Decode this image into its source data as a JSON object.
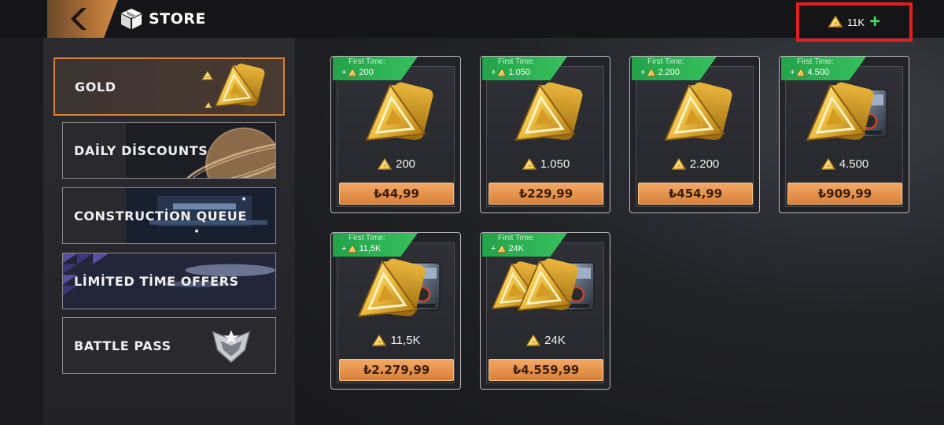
{
  "header": {
    "title": "STORE",
    "currency_value": "11K",
    "add_label": "+"
  },
  "sidebar": {
    "items": [
      {
        "label": "GOLD",
        "active": true
      },
      {
        "label": "DAİLY DİSCOUNTS",
        "active": false
      },
      {
        "label": "CONSTRUCTİON QUEUE",
        "active": false
      },
      {
        "label": "LİMİTED TİME OFFERS",
        "active": false
      },
      {
        "label": "BATTLE PASS",
        "active": false
      }
    ]
  },
  "offers": [
    {
      "first_time_label": "First Time:",
      "bonus": "+ ",
      "bonus_value": "200",
      "amount": "200",
      "price": "₺44,99",
      "art": "gold-cards-icon"
    },
    {
      "first_time_label": "First Time:",
      "bonus": "+ ",
      "bonus_value": "1.050",
      "amount": "1.050",
      "price": "₺229,99",
      "art": "gold-cards-icon"
    },
    {
      "first_time_label": "First Time:",
      "bonus": "+ ",
      "bonus_value": "2.200",
      "amount": "2.200",
      "price": "₺454,99",
      "art": "gold-cards-icon"
    },
    {
      "first_time_label": "First Time:",
      "bonus": "+ ",
      "bonus_value": "4.500",
      "amount": "4.500",
      "price": "₺909,99",
      "art": "gold-cards-crate-icon"
    },
    {
      "first_time_label": "First Time:",
      "bonus": "+ ",
      "bonus_value": "11,5K",
      "amount": "11,5K",
      "price": "₺2.279,99",
      "art": "gold-cards-crate-icon"
    },
    {
      "first_time_label": "First Time:",
      "bonus": "+ ",
      "bonus_value": "24K",
      "amount": "24K",
      "price": "₺4.559,99",
      "art": "gold-cards-double-crate-icon"
    }
  ],
  "colors": {
    "accent": "#d8813a",
    "ribbon": "#2fb556",
    "price_button": "#e89551",
    "highlight_box": "#e02020"
  }
}
